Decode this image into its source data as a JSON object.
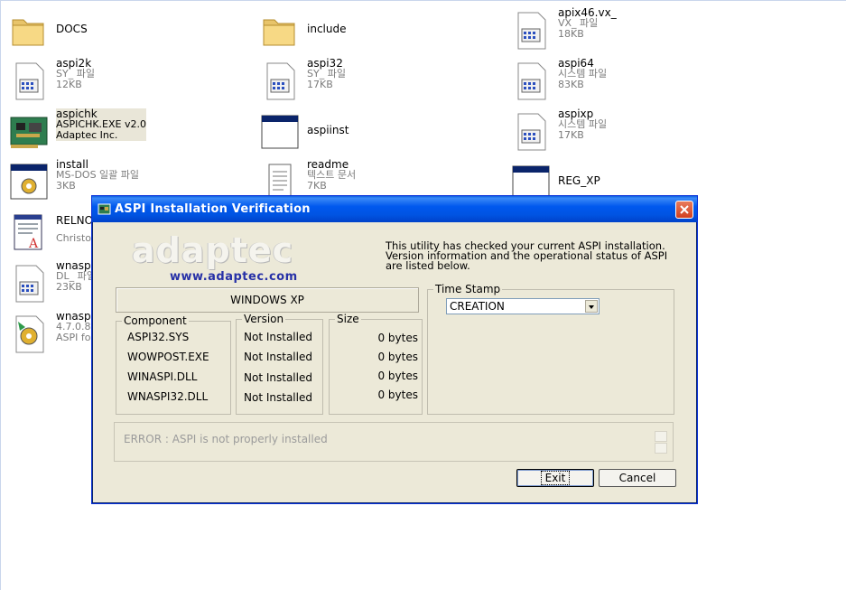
{
  "desktop": {
    "items": [
      {
        "name": "DOCS"
      },
      {
        "name": "include"
      },
      {
        "name": "apix46.vx_",
        "type": "VX_ 파일",
        "size": "18KB"
      },
      {
        "name": "aspi2k",
        "type": "SY_ 파일",
        "size": "12KB"
      },
      {
        "name": "aspi32",
        "type": "SY_ 파일",
        "size": "17KB"
      },
      {
        "name": "aspi64",
        "type": "시스템 파일",
        "size": "83KB"
      },
      {
        "name": "aspichk",
        "type": "ASPICHK.EXE v2.0",
        "size": "Adaptec Inc."
      },
      {
        "name": "aspiinst"
      },
      {
        "name": "aspixp",
        "type": "시스템 파일",
        "size": "17KB"
      },
      {
        "name": "install",
        "type": "MS-DOS 일괄 파일",
        "size": "3KB"
      },
      {
        "name": "readme",
        "type": "텍스트 문서",
        "size": "7KB"
      },
      {
        "name": "REG_XP"
      },
      {
        "name": "RELNO",
        "type": "Christop"
      },
      {
        "name": "wnaspi",
        "type": "DL_ 파일",
        "size": "23KB"
      },
      {
        "name": "wnaspi",
        "type": "4.7.0.8",
        "size": "ASPI fo"
      }
    ]
  },
  "dialog": {
    "title": "ASPI Installation Verification",
    "logo_word": "adaptec",
    "logo_url": "www.adaptec.com",
    "info_lines": [
      "This utility has checked your current ASPI installation.",
      "Version information and the operational status of ASPI",
      "are listed below."
    ],
    "os": "WINDOWS XP",
    "component_label": "Component",
    "version_label": "Version",
    "size_label": "Size",
    "components": [
      {
        "name": "ASPI32.SYS",
        "version": "Not Installed",
        "size": "0 bytes"
      },
      {
        "name": "WOWPOST.EXE",
        "version": "Not Installed",
        "size": "0 bytes"
      },
      {
        "name": "WINASPI.DLL",
        "version": "Not Installed",
        "size": "0 bytes"
      },
      {
        "name": "WNASPI32.DLL",
        "version": "Not Installed",
        "size": "0 bytes"
      }
    ],
    "timestamp_label": "Time Stamp",
    "timestamp_value": "CREATION",
    "error": "ERROR : ASPI is not properly installed",
    "exit_label": "Exit",
    "cancel_label": "Cancel"
  },
  "colors": {
    "title_bar": "#0054e3",
    "dialog_bg": "#ece9d8",
    "close_button": "#d2401f",
    "logo_url": "#2731a7"
  }
}
